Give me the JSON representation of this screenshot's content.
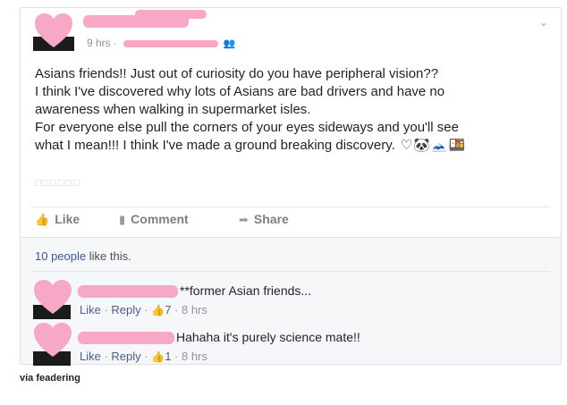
{
  "post": {
    "timestamp": "9 hrs ·",
    "lines": [
      "Asians friends!! Just out of curiosity do you have peripheral vision??",
      "I think I've discovered why lots of Asians are bad drivers and have no",
      "awareness when walking in supermarket isles.",
      "For everyone else pull the corners of your eyes sideways and you'll see",
      "what I mean!!! I think I've made a ground breaking discovery."
    ],
    "emojis": "♡🐼🗻🍱",
    "placeholder_boxes": "□□□□□□"
  },
  "actions": {
    "like": "Like",
    "comment": "Comment",
    "share": "Share"
  },
  "likes_summary": {
    "link": "10 people",
    "rest": " like this."
  },
  "comments": [
    {
      "text": "**former Asian friends...",
      "like": "Like",
      "reply": "Reply",
      "sep": " · ",
      "count": "7",
      "time": "8 hrs"
    },
    {
      "text": "Hahaha it's purely science mate!!",
      "like": "Like",
      "reply": "Reply",
      "sep": " · ",
      "count": "1",
      "time": "8 hrs"
    }
  ],
  "source_credit": "via feadering",
  "colors": {
    "redaction_pink": "#f7a8c6",
    "link_blue": "#365899",
    "muted_gray": "#90949c"
  },
  "icons": {
    "menu": "chevron-down-icon",
    "audience": "friends-icon",
    "like": "thumbs-up-icon",
    "comment": "speech-bubble-icon",
    "share": "share-arrow-icon"
  }
}
